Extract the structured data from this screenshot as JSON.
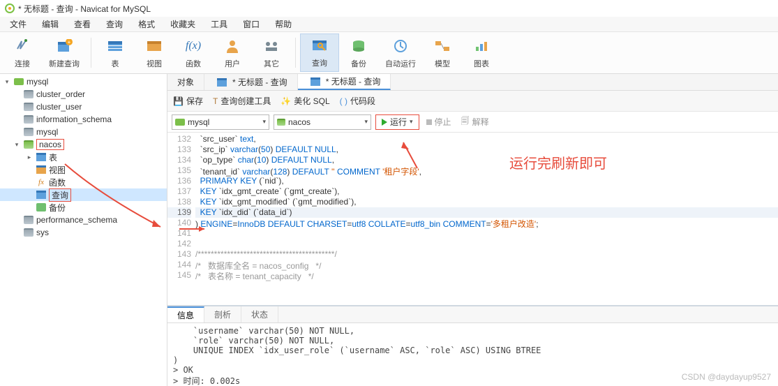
{
  "window": {
    "title": "* 无标题 - 查询 - Navicat for MySQL"
  },
  "menu": {
    "file": "文件",
    "edit": "编辑",
    "view": "查看",
    "query": "查询",
    "format": "格式",
    "favorites": "收藏夹",
    "tools": "工具",
    "window": "窗口",
    "help": "帮助"
  },
  "toolbar": {
    "connect": "连接",
    "new_query": "新建查询",
    "table": "表",
    "view": "视图",
    "function": "函数",
    "user": "用户",
    "other": "其它",
    "query": "查询",
    "backup": "备份",
    "auto_run": "自动运行",
    "model": "模型",
    "chart": "图表"
  },
  "sidebar": {
    "conn": "mysql",
    "items": [
      "cluster_order",
      "cluster_user",
      "information_schema",
      "mysql",
      "nacos",
      "performance_schema",
      "sys"
    ],
    "nacos_children": {
      "table": "表",
      "view": "视图",
      "function": "函数",
      "query": "查询",
      "backup": "备份"
    }
  },
  "tabs": {
    "objects": "对象",
    "tab1": "* 无标题 - 查询",
    "tab2": "* 无标题 - 查询"
  },
  "actions": {
    "save": "保存",
    "builder": "查询创建工具",
    "beautify": "美化 SQL",
    "snippet": "代码段"
  },
  "filter": {
    "conn": "mysql",
    "db": "nacos",
    "run": "运行",
    "stop": "停止",
    "explain": "解释"
  },
  "editor_lines": [
    {
      "n": 132,
      "t": "  `src_user` text,"
    },
    {
      "n": 133,
      "t": "  `src_ip` varchar(50) DEFAULT NULL,"
    },
    {
      "n": 134,
      "t": "  `op_type` char(10) DEFAULT NULL,"
    },
    {
      "n": 135,
      "t": "  `tenant_id` varchar(128) DEFAULT '' COMMENT '租户字段',"
    },
    {
      "n": 136,
      "t": "  PRIMARY KEY (`nid`),"
    },
    {
      "n": 137,
      "t": "  KEY `idx_gmt_create` (`gmt_create`),"
    },
    {
      "n": 138,
      "t": "  KEY `idx_gmt_modified` (`gmt_modified`),"
    },
    {
      "n": 139,
      "t": "  KEY `idx_did` (`data_id`)"
    },
    {
      "n": 140,
      "t": ") ENGINE=InnoDB DEFAULT CHARSET=utf8 COLLATE=utf8_bin COMMENT='多租户改造';"
    },
    {
      "n": 141,
      "t": ""
    },
    {
      "n": 142,
      "t": ""
    },
    {
      "n": 143,
      "t": "/******************************************/"
    },
    {
      "n": 144,
      "t": "/*   数据库全名 = nacos_config   */"
    },
    {
      "n": 145,
      "t": "/*   表名称 = tenant_capacity   */"
    }
  ],
  "result_tabs": {
    "info": "信息",
    "profile": "剖析",
    "status": "状态"
  },
  "result_text": "    `username` varchar(50) NOT NULL,\n    `role` varchar(50) NOT NULL,\n    UNIQUE INDEX `idx_user_role` (`username` ASC, `role` ASC) USING BTREE\n)\n> OK\n> 时间: 0.002s",
  "annotation": "运行完刷新即可",
  "watermark": "CSDN @daydayup9527"
}
